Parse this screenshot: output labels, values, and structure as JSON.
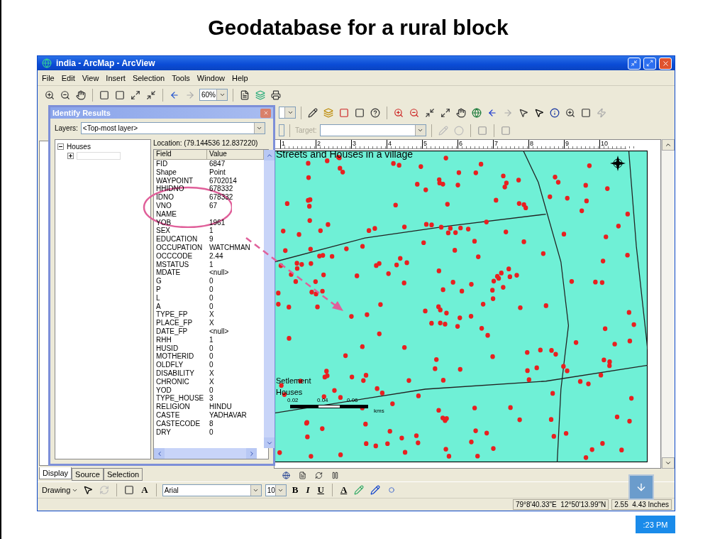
{
  "slide": {
    "title": "Geodatabase for a rural block"
  },
  "window": {
    "title": "india - ArcMap - ArcView"
  },
  "menu": [
    "File",
    "Edit",
    "View",
    "Insert",
    "Selection",
    "Tools",
    "Window",
    "Help"
  ],
  "toolbar": {
    "zoom": "60%",
    "target_label": "Target:"
  },
  "identify": {
    "title": "Identify Results",
    "layers_label": "Layers:",
    "layer": "<Top-most layer>",
    "tree": [
      {
        "label": "Houses",
        "expanded": true
      }
    ],
    "location": "Location: (79.144536 12.837220)",
    "columns": [
      "Field",
      "Value"
    ],
    "rows": [
      {
        "field": "FID",
        "value": "6847"
      },
      {
        "field": "Shape",
        "value": "Point"
      },
      {
        "field": "WAYPOINT",
        "value": "6702014"
      },
      {
        "field": "HHIDNO",
        "value": "678332"
      },
      {
        "field": "IDNO",
        "value": "678332"
      },
      {
        "field": "VNO",
        "value": "67"
      },
      {
        "field": "NAME"
      },
      {
        "field": "YOB",
        "value": "1961"
      },
      {
        "field": "SEX",
        "value": "1"
      },
      {
        "field": "EDUCATION",
        "value": "9"
      },
      {
        "field": "OCCUPATION",
        "value": "WATCHMAN"
      },
      {
        "field": "OCCCODE",
        "value": "2.44"
      },
      {
        "field": "MSTATUS",
        "value": "1"
      },
      {
        "field": "MDATE",
        "value": "<null>"
      },
      {
        "field": "G",
        "value": "0"
      },
      {
        "field": "P",
        "value": "0"
      },
      {
        "field": "L",
        "value": "0"
      },
      {
        "field": "A",
        "value": "0"
      },
      {
        "field": "TYPE_FP",
        "value": "X"
      },
      {
        "field": "PLACE_FP",
        "value": "X"
      },
      {
        "field": "DATE_FP",
        "value": "<null>"
      },
      {
        "field": "RHH",
        "value": "1"
      },
      {
        "field": "HUSID",
        "value": "0"
      },
      {
        "field": "MOTHERID",
        "value": "0"
      },
      {
        "field": "OLDFLY",
        "value": "0"
      },
      {
        "field": "DISABILITY",
        "value": "X"
      },
      {
        "field": "CHRONIC",
        "value": "X"
      },
      {
        "field": "YOD",
        "value": "0"
      },
      {
        "field": "TYPE_HOUSE",
        "value": "3"
      },
      {
        "field": "RELIGION",
        "value": "HINDU"
      },
      {
        "field": "CASTE",
        "value": "YADHAVAR"
      },
      {
        "field": "CASTECODE",
        "value": "8"
      },
      {
        "field": "DRY",
        "value": "0"
      }
    ]
  },
  "toc_tabs": [
    {
      "label": "Display",
      "selected": true
    },
    {
      "label": "Source",
      "selected": false
    },
    {
      "label": "Selection",
      "selected": false
    }
  ],
  "ruler": [
    "1",
    "2",
    "3",
    "4",
    "5",
    "6",
    "7",
    "8",
    "9",
    "10"
  ],
  "map": {
    "title": "Streets and Houses in a village",
    "legend": [
      "Setlement",
      "Houses"
    ],
    "scale_labels": [
      "0.02",
      "0.04",
      "0.06"
    ],
    "scale_unit": "kms"
  },
  "drawing_toolbar": {
    "menu": "Drawing",
    "font": "Arial",
    "size": "10",
    "bold": "B",
    "italic": "I",
    "underline": "U",
    "text_color": "A",
    "font_color": "A"
  },
  "status": {
    "coordinates": "79°8'40.33\"E  12°50'13.99\"N",
    "page": "2.55  4.43 Inches"
  },
  "clock": ":23 PM"
}
